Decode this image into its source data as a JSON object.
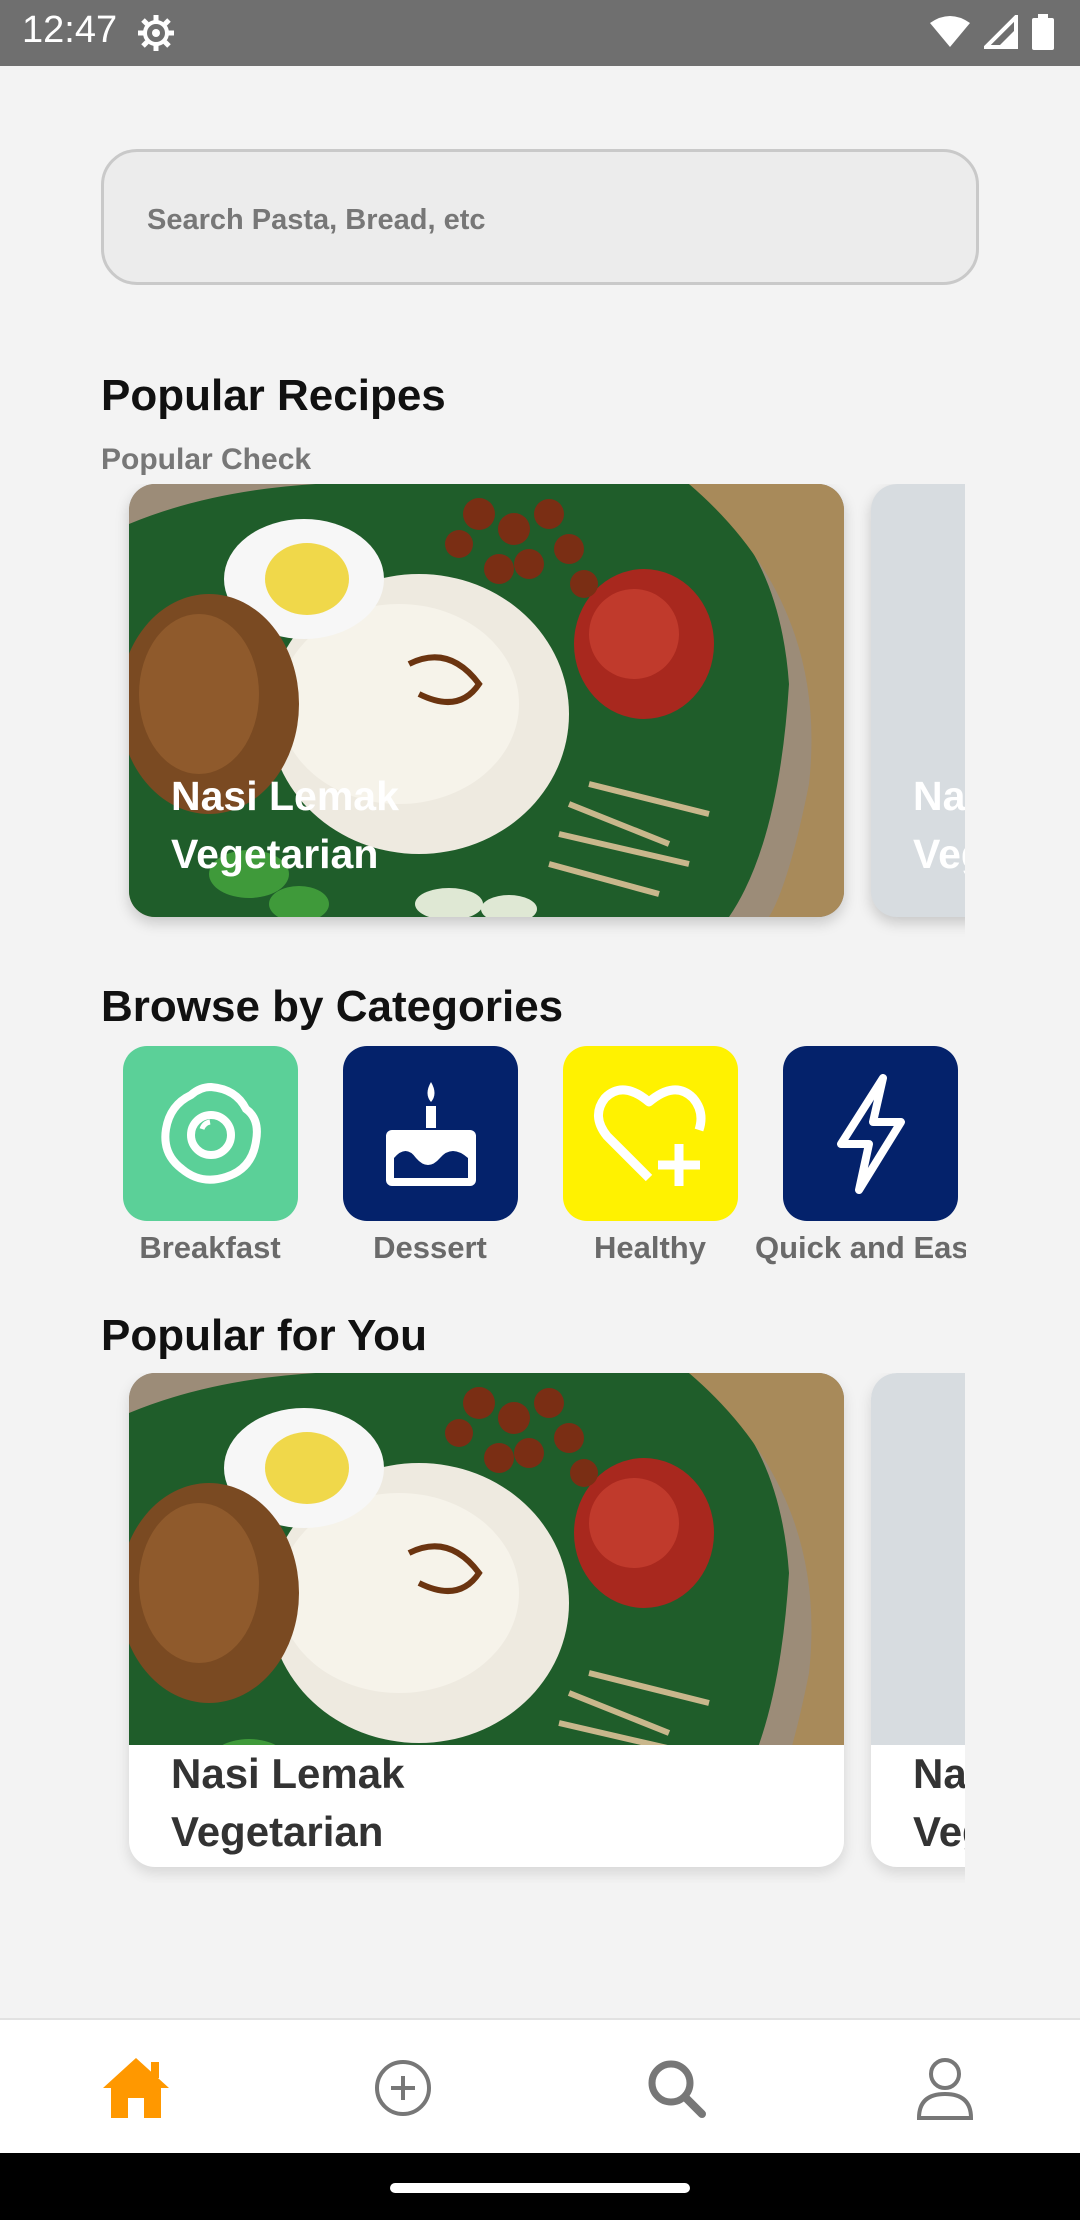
{
  "status": {
    "time": "12:47"
  },
  "search": {
    "placeholder": "Search Pasta, Bread, etc"
  },
  "popular_recipes": {
    "title": "Popular Recipes",
    "subtitle": "Popular Check",
    "cards": [
      {
        "title": "Nasi Lemak Vegetarian"
      },
      {
        "title": "Nasi Lemak Vegetarian"
      }
    ]
  },
  "categories": {
    "title": "Browse by Categories",
    "items": [
      {
        "label": "Breakfast",
        "icon": "fried-egg-icon",
        "color": "#5bd098"
      },
      {
        "label": "Dessert",
        "icon": "cake-icon",
        "color": "#04226b"
      },
      {
        "label": "Healthy",
        "icon": "heart-plus-icon",
        "color": "#fff200"
      },
      {
        "label": "Quick and Easy",
        "icon": "lightning-icon",
        "color": "#04226b"
      }
    ]
  },
  "popular_for_you": {
    "title": "Popular for You",
    "cards": [
      {
        "title": "Nasi Lemak Vegetarian"
      },
      {
        "title": "Nasi Lemak Vegetarian"
      }
    ]
  },
  "bottom_nav": [
    {
      "icon": "home-icon",
      "active": true
    },
    {
      "icon": "add-circle-icon",
      "active": false
    },
    {
      "icon": "search-icon",
      "active": false
    },
    {
      "icon": "profile-icon",
      "active": false
    }
  ],
  "colors": {
    "accent": "#ff9800",
    "nav_inactive": "#777777"
  }
}
